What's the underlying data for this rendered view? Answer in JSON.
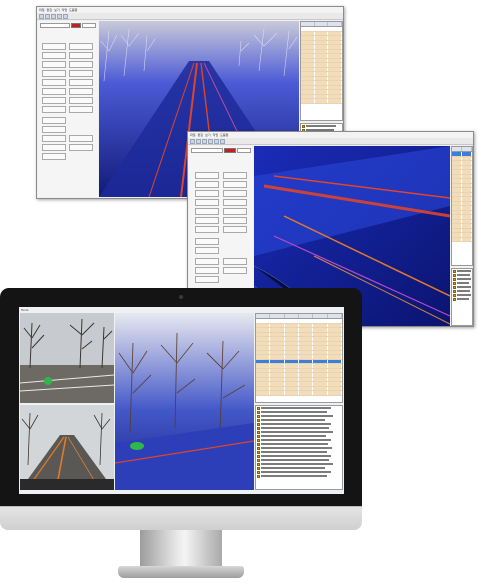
{
  "windows": {
    "back": {
      "menu": [
        "파일",
        "편집",
        "보기",
        "작업",
        "도움말"
      ]
    },
    "middle": {
      "menu": [
        "파일",
        "편집",
        "보기",
        "작업",
        "도움말"
      ]
    },
    "monitor_app": {
      "title": "Tools"
    }
  },
  "colors": {
    "cloud_bg": "#0a0d3a",
    "road_marking": "#e0442a",
    "table_row": "#f3dcb8",
    "selected_row": "#3c7fd8",
    "marker": "#2fb84a"
  },
  "icons": {
    "folder": "folder-icon",
    "toolbar": "toolbar-button-icon",
    "camera": "camera-icon"
  }
}
